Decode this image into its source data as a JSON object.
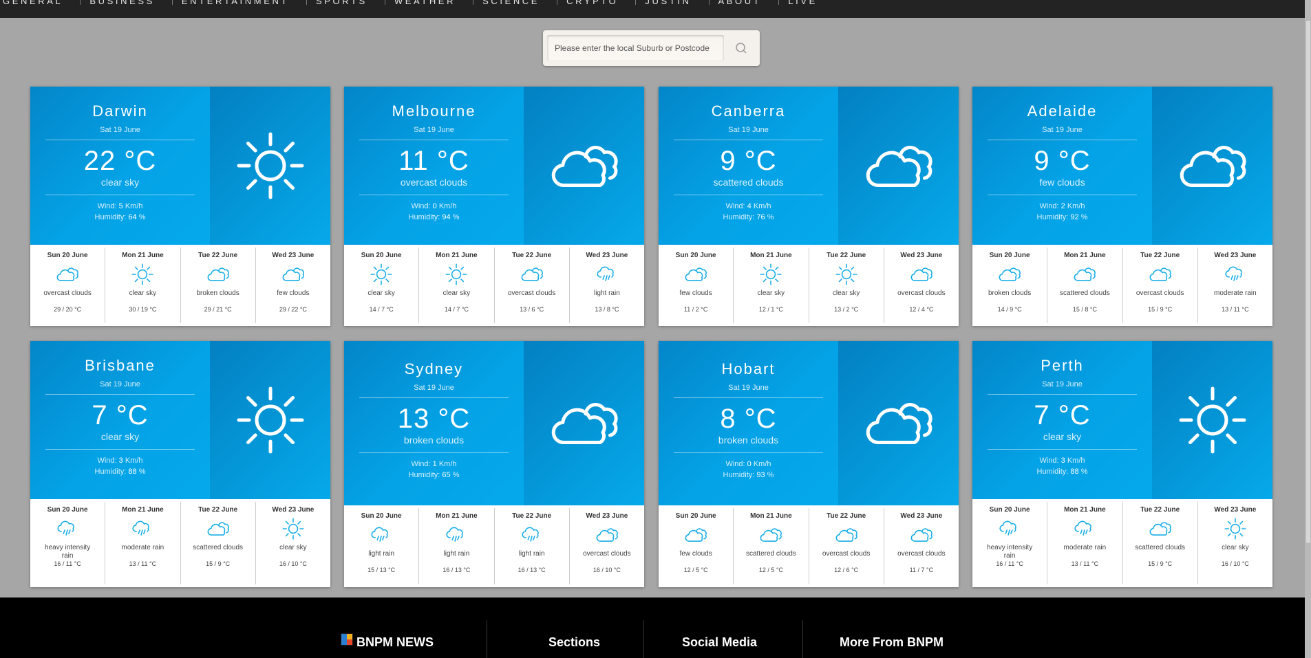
{
  "nav": {
    "items": [
      "GENERAL",
      "BUSINESS",
      "ENTERTAINMENT",
      "SPORTS",
      "WEATHER",
      "SCIENCE",
      "CRYPTO",
      "JUSTIN",
      "ABOUT",
      "LIVE"
    ]
  },
  "search": {
    "placeholder": "Please enter the local Suburb or Postcode",
    "icon": "search-icon"
  },
  "colors": {
    "card_gradient_start": "#0386c9",
    "card_gradient_end": "#06aff0",
    "forecast_icon": "#19aee8",
    "page_background": "#a6a6a6"
  },
  "cards": [
    {
      "city": "Darwin",
      "date": "Sat 19 June",
      "temp": "22 °C",
      "desc": "clear sky",
      "wind_label": "Wind:",
      "wind_value": "5",
      "wind_unit": "Km/h",
      "humidity_label": "Humidity:",
      "humidity_value": "64",
      "humidity_unit": "%",
      "icon": "sun-icon",
      "forecast": [
        {
          "day": "Sun 20 June",
          "icon": "clouds-icon",
          "desc": "overcast clouds",
          "range": "29 / 20 °C"
        },
        {
          "day": "Mon 21 June",
          "icon": "sun-icon",
          "desc": "clear sky",
          "range": "30 / 19 °C"
        },
        {
          "day": "Tue 22 June",
          "icon": "clouds-icon",
          "desc": "broken clouds",
          "range": "29 / 21 °C"
        },
        {
          "day": "Wed 23 June",
          "icon": "clouds-icon",
          "desc": "few clouds",
          "range": "29 / 22 °C"
        }
      ]
    },
    {
      "city": "Melbourne",
      "date": "Sat 19 June",
      "temp": "11 °C",
      "desc": "overcast clouds",
      "wind_label": "Wind:",
      "wind_value": "0",
      "wind_unit": "Km/h",
      "humidity_label": "Humidity:",
      "humidity_value": "94",
      "humidity_unit": "%",
      "icon": "clouds-icon",
      "forecast": [
        {
          "day": "Sun 20 June",
          "icon": "sun-icon",
          "desc": "clear sky",
          "range": "14 / 7 °C"
        },
        {
          "day": "Mon 21 June",
          "icon": "sun-icon",
          "desc": "clear sky",
          "range": "14 / 7 °C"
        },
        {
          "day": "Tue 22 June",
          "icon": "clouds-icon",
          "desc": "overcast clouds",
          "range": "13 / 6 °C"
        },
        {
          "day": "Wed 23 June",
          "icon": "rain-icon",
          "desc": "light rain",
          "range": "13 / 8 °C"
        }
      ]
    },
    {
      "city": "Canberra",
      "date": "Sat 19 June",
      "temp": "9 °C",
      "desc": "scattered clouds",
      "wind_label": "Wind:",
      "wind_value": "4",
      "wind_unit": "Km/h",
      "humidity_label": "Humidity:",
      "humidity_value": "76",
      "humidity_unit": "%",
      "icon": "clouds-icon",
      "forecast": [
        {
          "day": "Sun 20 June",
          "icon": "clouds-icon",
          "desc": "few clouds",
          "range": "11 / 2 °C"
        },
        {
          "day": "Mon 21 June",
          "icon": "sun-icon",
          "desc": "clear sky",
          "range": "12 / 1 °C"
        },
        {
          "day": "Tue 22 June",
          "icon": "sun-icon",
          "desc": "clear sky",
          "range": "13 / 2 °C"
        },
        {
          "day": "Wed 23 June",
          "icon": "clouds-icon",
          "desc": "overcast clouds",
          "range": "12 / 4 °C"
        }
      ]
    },
    {
      "city": "Adelaide",
      "date": "Sat 19 June",
      "temp": "9 °C",
      "desc": "few clouds",
      "wind_label": "Wind:",
      "wind_value": "2",
      "wind_unit": "Km/h",
      "humidity_label": "Humidity:",
      "humidity_value": "92",
      "humidity_unit": "%",
      "icon": "clouds-icon",
      "forecast": [
        {
          "day": "Sun 20 June",
          "icon": "clouds-icon",
          "desc": "broken clouds",
          "range": "14 / 9 °C"
        },
        {
          "day": "Mon 21 June",
          "icon": "clouds-icon",
          "desc": "scattered clouds",
          "range": "15 / 8 °C"
        },
        {
          "day": "Tue 22 June",
          "icon": "clouds-icon",
          "desc": "overcast clouds",
          "range": "15 / 9 °C"
        },
        {
          "day": "Wed 23 June",
          "icon": "rain-icon",
          "desc": "moderate rain",
          "range": "13 / 11 °C"
        }
      ]
    },
    {
      "city": "Brisbane",
      "date": "Sat 19 June",
      "temp": "7 °C",
      "desc": "clear sky",
      "wind_label": "Wind:",
      "wind_value": "3",
      "wind_unit": "Km/h",
      "humidity_label": "Humidity:",
      "humidity_value": "88",
      "humidity_unit": "%",
      "icon": "sun-icon",
      "forecast": [
        {
          "day": "Sun 20 June",
          "icon": "rain-icon",
          "desc": "heavy intensity rain",
          "range": "16 / 11 °C"
        },
        {
          "day": "Mon 21 June",
          "icon": "rain-icon",
          "desc": "moderate rain",
          "range": "13 / 11 °C"
        },
        {
          "day": "Tue 22 June",
          "icon": "clouds-icon",
          "desc": "scattered clouds",
          "range": "15 / 9 °C"
        },
        {
          "day": "Wed 23 June",
          "icon": "sun-icon",
          "desc": "clear sky",
          "range": "16 / 10 °C"
        }
      ]
    },
    {
      "city": "Sydney",
      "date": "Sat 19 June",
      "temp": "13 °C",
      "desc": "broken clouds",
      "wind_label": "Wind:",
      "wind_value": "1",
      "wind_unit": "Km/h",
      "humidity_label": "Humidity:",
      "humidity_value": "65",
      "humidity_unit": "%",
      "icon": "clouds-icon",
      "forecast": [
        {
          "day": "Sun 20 June",
          "icon": "rain-icon",
          "desc": "light rain",
          "range": "15 / 13 °C"
        },
        {
          "day": "Mon 21 June",
          "icon": "rain-icon",
          "desc": "light rain",
          "range": "16 / 13 °C"
        },
        {
          "day": "Tue 22 June",
          "icon": "rain-icon",
          "desc": "light rain",
          "range": "16 / 13 °C"
        },
        {
          "day": "Wed 23 June",
          "icon": "clouds-icon",
          "desc": "overcast clouds",
          "range": "16 / 10 °C"
        }
      ]
    },
    {
      "city": "Hobart",
      "date": "Sat 19 June",
      "temp": "8 °C",
      "desc": "broken clouds",
      "wind_label": "Wind:",
      "wind_value": "0",
      "wind_unit": "Km/h",
      "humidity_label": "Humidity:",
      "humidity_value": "93",
      "humidity_unit": "%",
      "icon": "clouds-icon",
      "forecast": [
        {
          "day": "Sun 20 June",
          "icon": "clouds-icon",
          "desc": "few clouds",
          "range": "12 / 5 °C"
        },
        {
          "day": "Mon 21 June",
          "icon": "clouds-icon",
          "desc": "scattered clouds",
          "range": "12 / 5 °C"
        },
        {
          "day": "Tue 22 June",
          "icon": "clouds-icon",
          "desc": "overcast clouds",
          "range": "12 / 6 °C"
        },
        {
          "day": "Wed 23 June",
          "icon": "clouds-icon",
          "desc": "overcast clouds",
          "range": "11 / 7 °C"
        }
      ]
    },
    {
      "city": "Perth",
      "date": "Sat 19 June",
      "temp": "7 °C",
      "desc": "clear sky",
      "wind_label": "Wind:",
      "wind_value": "3",
      "wind_unit": "Km/h",
      "humidity_label": "Humidity:",
      "humidity_value": "88",
      "humidity_unit": "%",
      "icon": "sun-icon",
      "forecast": [
        {
          "day": "Sun 20 June",
          "icon": "rain-icon",
          "desc": "heavy intensity rain",
          "range": "16 / 11 °C"
        },
        {
          "day": "Mon 21 June",
          "icon": "rain-icon",
          "desc": "moderate rain",
          "range": "13 / 11 °C"
        },
        {
          "day": "Tue 22 June",
          "icon": "clouds-icon",
          "desc": "scattered clouds",
          "range": "15 / 9 °C"
        },
        {
          "day": "Wed 23 June",
          "icon": "sun-icon",
          "desc": "clear sky",
          "range": "16 / 10 °C"
        }
      ]
    }
  ],
  "footer": {
    "brand": "BNPM NEWS",
    "brand_logo_text": "BN",
    "sections": "Sections",
    "social": "Social Media",
    "more": "More From BNPM"
  }
}
